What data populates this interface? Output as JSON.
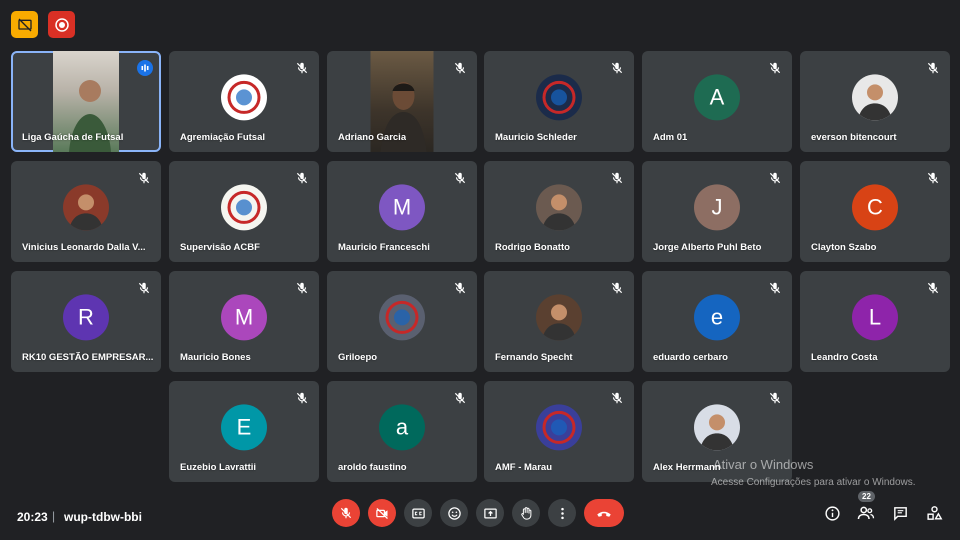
{
  "participants": [
    {
      "name": "Liga Gaúcha de Futsal",
      "kind": "video",
      "speaking": true
    },
    {
      "name": "Agremiação Futsal",
      "kind": "logo",
      "logo": "acf-logo",
      "bg": "#ffffff"
    },
    {
      "name": "Adriano Garcia",
      "kind": "video"
    },
    {
      "name": "Mauricio Schleder",
      "kind": "logo",
      "logo": "shield-logo",
      "bg": "#1b2b4a"
    },
    {
      "name": "Adm 01",
      "kind": "initial",
      "initial": "A",
      "color": "#1e6b52"
    },
    {
      "name": "everson bitencourt",
      "kind": "photo",
      "bg": "#e8e8e8"
    },
    {
      "name": "Vinicius Leonardo Dalla V...",
      "kind": "photo",
      "bg": "#8a3a2a"
    },
    {
      "name": "Supervisão ACBF",
      "kind": "logo",
      "logo": "acbf-logo",
      "bg": "#f5f5f0"
    },
    {
      "name": "Mauricio Franceschi",
      "kind": "initial",
      "initial": "M",
      "color": "#7e57c2"
    },
    {
      "name": "Rodrigo Bonatto",
      "kind": "photo",
      "bg": "#6b5a50"
    },
    {
      "name": "Jorge Alberto Puhl Beto",
      "kind": "initial",
      "initial": "J",
      "color": "#8d6e63"
    },
    {
      "name": "Clayton Szabo",
      "kind": "initial",
      "initial": "C",
      "color": "#d84315"
    },
    {
      "name": "RK10 GESTÃO EMPRESAR...",
      "kind": "initial",
      "initial": "R",
      "color": "#5e35b1"
    },
    {
      "name": "Mauricio Bones",
      "kind": "initial",
      "initial": "M",
      "color": "#ab47bc"
    },
    {
      "name": "Griloepo",
      "kind": "logo",
      "logo": "griloepo-logo",
      "bg": "#5a6070"
    },
    {
      "name": "Fernando Specht",
      "kind": "photo",
      "bg": "#5a4030"
    },
    {
      "name": "eduardo cerbaro",
      "kind": "initial",
      "initial": "e",
      "color": "#1565c0"
    },
    {
      "name": "Leandro Costa",
      "kind": "initial",
      "initial": "L",
      "color": "#8e24aa"
    },
    {
      "name": "Euzebio Lavrattii",
      "kind": "initial",
      "initial": "E",
      "color": "#0097a7"
    },
    {
      "name": "aroldo faustino",
      "kind": "initial",
      "initial": "a",
      "color": "#00695c"
    },
    {
      "name": "AMF - Marau",
      "kind": "logo",
      "logo": "amf-logo",
      "bg": "#3a3f9a"
    },
    {
      "name": "Alex Herrmann",
      "kind": "photo",
      "bg": "#d8dde6"
    }
  ],
  "watermark": {
    "title": "Ativar o Windows",
    "subtitle": "Acesse Configurações para ativar o Windows."
  },
  "bottom": {
    "time": "20:23",
    "separator": "|",
    "meeting_code": "wup-tdbw-bbi",
    "people_count": "22"
  },
  "colors": {
    "background": "#202124",
    "tile": "#3c4043",
    "accent": "#8ab4f8",
    "danger": "#ea4335"
  },
  "icons": {
    "top": [
      "presentation-off-icon",
      "record-icon"
    ],
    "controls": [
      "mic-off-icon",
      "camera-off-icon",
      "captions-icon",
      "emoji-icon",
      "present-icon",
      "raise-hand-icon",
      "more-options-icon",
      "end-call-icon"
    ],
    "right": [
      "info-icon",
      "people-icon",
      "chat-icon",
      "activities-icon"
    ]
  }
}
